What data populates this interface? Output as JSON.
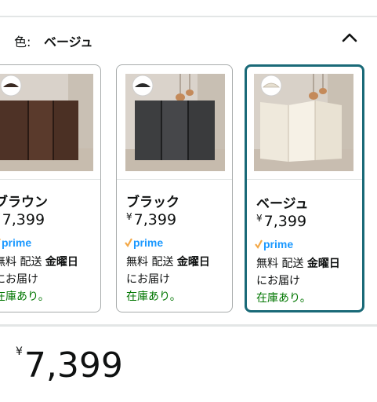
{
  "variant_selector": {
    "label": "色:",
    "selected_value": "ベージュ",
    "collapse_icon": "chevron-up-icon"
  },
  "swatches": [
    {
      "name": "ブラウン",
      "currency": "¥",
      "price": "7,399",
      "prime_label": "prime",
      "delivery_prefix": "無料 配送",
      "delivery_day": "金曜日",
      "delivery_suffix": "にお届け",
      "stock": "在庫あり。",
      "panel_color": "#4e3226",
      "selected": false
    },
    {
      "name": "ブラック",
      "currency": "¥",
      "price": "7,399",
      "prime_label": "prime",
      "delivery_prefix": "無料 配送",
      "delivery_day": "金曜日",
      "delivery_suffix": "にお届け",
      "stock": "在庫あり。",
      "panel_color": "#3d3e40",
      "selected": false
    },
    {
      "name": "ベージュ",
      "currency": "¥",
      "price": "7,399",
      "prime_label": "prime",
      "delivery_prefix": "無料 配送",
      "delivery_day": "金曜日",
      "delivery_suffix": "にお届け",
      "stock": "在庫あり。",
      "panel_color": "#efe9dc",
      "selected": true
    }
  ],
  "price_display": {
    "currency": "¥",
    "amount": "7,399"
  },
  "colors": {
    "selected_border": "#1a6a78",
    "in_stock": "#007600",
    "prime_blue": "#1a98ff",
    "prime_check": "#f3a847"
  }
}
